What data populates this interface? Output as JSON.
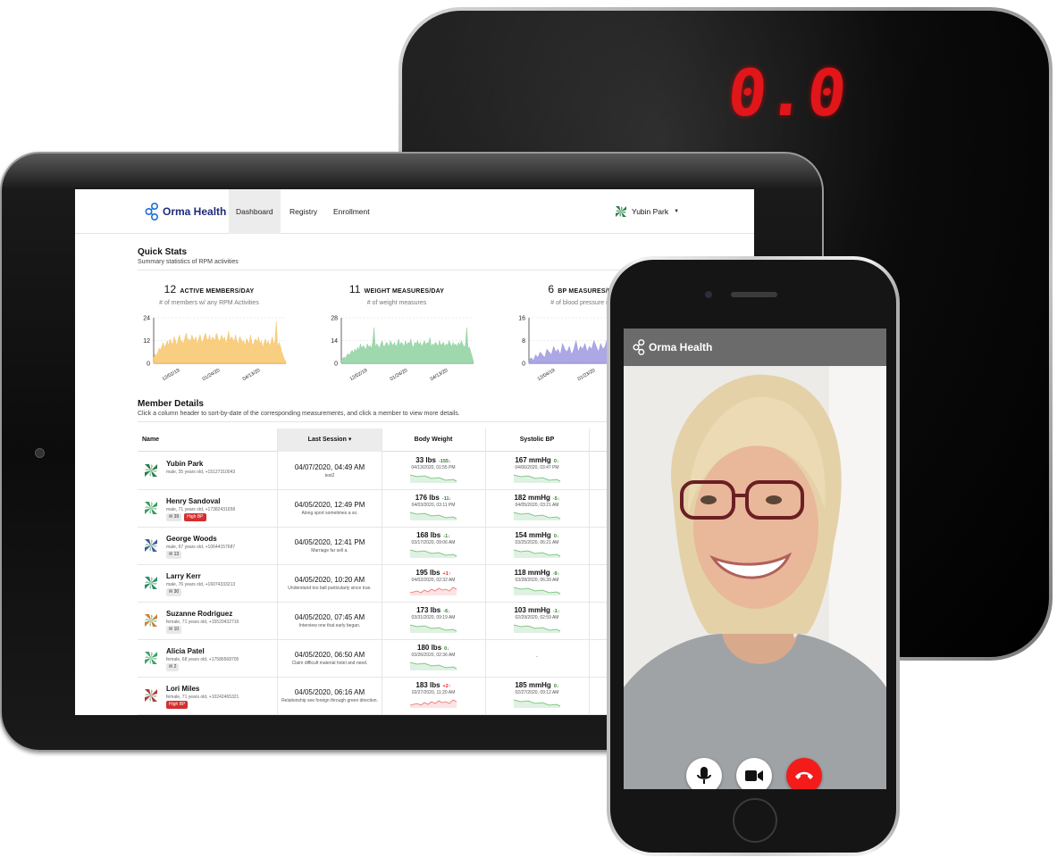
{
  "scale": {
    "display": "0.0"
  },
  "app": {
    "brand": "Orma Health",
    "nav": [
      "Dashboard",
      "Registry",
      "Enrollment"
    ],
    "active_tab": "Dashboard",
    "user": "Yubin Park"
  },
  "quick_stats": {
    "title": "Quick Stats",
    "subtitle": "Summary statistics of RPM activities",
    "cards": [
      {
        "value": "12",
        "label": "ACTIVE MEMBERS/DAY",
        "desc": "# of members w/ any RPM Activities",
        "color": "#f7c66b"
      },
      {
        "value": "11",
        "label": "WEIGHT MEASURES/DAY",
        "desc": "# of weight measures",
        "color": "#8fd1a0"
      },
      {
        "value": "6",
        "label": "BP MEASURES/DAY",
        "desc": "# of blood pressure mea",
        "color": "#9e98e0"
      }
    ]
  },
  "member_details": {
    "title": "Member Details",
    "subtitle": "Click a column header to sort-by-date of the corresponding measurements, and click a member to view more details.",
    "columns": [
      "Name",
      "Last Session",
      "Body Weight",
      "Systolic BP"
    ],
    "rows": [
      {
        "name": "Yubin Park",
        "info": "male, 35 years old, +15127310043",
        "msgs": "",
        "high_bp": "",
        "session": "04/07/2020, 04:49 AM",
        "note": "test2",
        "weight": "33 lbs",
        "w_delta": "-155",
        "w_dir": "down",
        "w_date": "04/13/2020, 01:55 PM",
        "bp": "167 mmHg",
        "bp_delta": "0",
        "bp_dir": "down",
        "bp_date": "04/06/2020, 03:47 PM"
      },
      {
        "name": "Henry Sandoval",
        "info": "male, 71 years old, +17382431658",
        "msgs": "39",
        "high_bp": "High BP",
        "session": "04/05/2020, 12:49 PM",
        "note": "Along sport sometimes a so.",
        "weight": "176 lbs",
        "w_delta": "-11",
        "w_dir": "down",
        "w_date": "04/03/2020, 03:11 PM",
        "bp": "182 mmHg",
        "bp_delta": "-5",
        "bp_dir": "down",
        "bp_date": "04/05/2020, 03:21 AM"
      },
      {
        "name": "George Woods",
        "info": "male, 67 years old, +10644157687",
        "msgs": "13",
        "high_bp": "",
        "session": "04/05/2020, 12:41 PM",
        "note": "Marriage far sell a.",
        "weight": "168 lbs",
        "w_delta": "-1",
        "w_dir": "down",
        "w_date": "03/17/2020, 09:06 AM",
        "bp": "154 mmHg",
        "bp_delta": "0",
        "bp_dir": "down",
        "bp_date": "03/25/2020, 06:21 AM"
      },
      {
        "name": "Larry Kerr",
        "info": "male, 76 years old, +16074333213",
        "msgs": "30",
        "high_bp": "",
        "session": "04/05/2020, 10:20 AM",
        "note": "Understand too ball particularly since true.",
        "weight": "195 lbs",
        "w_delta": "+1",
        "w_dir": "up",
        "w_date": "04/02/2020, 02:32 AM",
        "bp": "118 mmHg",
        "bp_delta": "-9",
        "bp_dir": "down",
        "bp_date": "03/28/2020, 06:39 AM"
      },
      {
        "name": "Suzanne Rodriguez",
        "info": "female, 71 years old, +15520432716",
        "msgs": "10",
        "high_bp": "",
        "session": "04/05/2020, 07:45 AM",
        "note": "Interview one that early began.",
        "weight": "173 lbs",
        "w_delta": "-6",
        "w_dir": "down",
        "w_date": "03/31/2020, 09:19 AM",
        "bp": "103 mmHg",
        "bp_delta": "-1",
        "bp_dir": "down",
        "bp_date": "02/29/2020, 02:59 AM"
      },
      {
        "name": "Alicia Patel",
        "info": "female, 68 years old, +17586568705",
        "msgs": "2",
        "high_bp": "",
        "session": "04/05/2020, 06:50 AM",
        "note": "Claim difficult material hotel and need.",
        "weight": "180 lbs",
        "w_delta": "0",
        "w_dir": "down",
        "w_date": "03/26/2020, 02:36 AM",
        "bp": "",
        "bp_delta": "",
        "bp_dir": "",
        "bp_date": "",
        "bp_empty": "-"
      },
      {
        "name": "Lori Miles",
        "info": "female, 71 years old, +10242465321",
        "msgs": "",
        "high_bp": "High BP",
        "session": "04/05/2020, 06:16 AM",
        "note": "Relationship see foreign through green direction.",
        "weight": "183 lbs",
        "w_delta": "+2",
        "w_dir": "up",
        "w_date": "02/27/2020, 11:20 AM",
        "bp": "185 mmHg",
        "bp_delta": "0",
        "bp_dir": "down",
        "bp_date": "02/27/2020, 09:12 AM"
      }
    ]
  },
  "chart_data": [
    {
      "type": "area",
      "title": "ACTIVE MEMBERS/DAY",
      "y_ticks": [
        "24",
        "12",
        "0"
      ],
      "ylim": [
        0,
        24
      ],
      "x_ticks": [
        "12/02/19",
        "01/24/20",
        "04/13/20"
      ],
      "color": "#f7c66b",
      "values": [
        3,
        5,
        4,
        6,
        8,
        7,
        9,
        11,
        8,
        10,
        12,
        9,
        13,
        11,
        10,
        14,
        12,
        9,
        13,
        15,
        11,
        12,
        10,
        14,
        16,
        12,
        13,
        11,
        15,
        13,
        12,
        14,
        10,
        13,
        15,
        12,
        11,
        14,
        16,
        13,
        12,
        15,
        11,
        14,
        13,
        12,
        16,
        14,
        11,
        13,
        15,
        12,
        14,
        10,
        13,
        17,
        12,
        14,
        13,
        11,
        15,
        12,
        10,
        14,
        13,
        11,
        12,
        9,
        13,
        12,
        10,
        15,
        11,
        9,
        12,
        13,
        11,
        14,
        10,
        12,
        8,
        11,
        13,
        10,
        12,
        9,
        11,
        14,
        10,
        12,
        22,
        8,
        11,
        9,
        6,
        4,
        2,
        1
      ]
    },
    {
      "type": "area",
      "title": "WEIGHT MEASURES/DAY",
      "y_ticks": [
        "28",
        "14",
        "0"
      ],
      "ylim": [
        0,
        28
      ],
      "x_ticks": [
        "12/02/19",
        "01/24/20",
        "04/13/20"
      ],
      "color": "#8fd1a0",
      "values": [
        2,
        3,
        4,
        3,
        5,
        6,
        5,
        7,
        8,
        6,
        9,
        7,
        10,
        8,
        12,
        9,
        11,
        10,
        8,
        12,
        10,
        11,
        9,
        13,
        22,
        10,
        12,
        11,
        9,
        12,
        14,
        10,
        11,
        13,
        12,
        10,
        14,
        12,
        11,
        13,
        10,
        12,
        15,
        11,
        13,
        12,
        10,
        14,
        11,
        13,
        12,
        15,
        11,
        10,
        13,
        12,
        14,
        11,
        13,
        10,
        12,
        14,
        11,
        13,
        12,
        16,
        10,
        12,
        11,
        13,
        12,
        10,
        14,
        11,
        12,
        13,
        10,
        12,
        11,
        14,
        12,
        10,
        13,
        11,
        12,
        10,
        13,
        11,
        14,
        12,
        10,
        11,
        22,
        9,
        10,
        7,
        4,
        1
      ]
    },
    {
      "type": "area",
      "title": "BP MEASURES/DAY",
      "y_ticks": [
        "16",
        "8",
        "0"
      ],
      "ylim": [
        0,
        16
      ],
      "x_ticks": [
        "12/04/19",
        "01/23/20"
      ],
      "color": "#9e98e0",
      "values": [
        1,
        2,
        1,
        3,
        2,
        4,
        3,
        2,
        5,
        4,
        3,
        6,
        4,
        5,
        3,
        7,
        5,
        4,
        6,
        3,
        5,
        8,
        4,
        6,
        5,
        7,
        4,
        6,
        5,
        8,
        6,
        4,
        7,
        5,
        6,
        9,
        5,
        7,
        6,
        4,
        8,
        6,
        5,
        7,
        6,
        10,
        5,
        7,
        6,
        8,
        5,
        7,
        6,
        5,
        8,
        6,
        7,
        5,
        6,
        8
      ]
    }
  ]
}
